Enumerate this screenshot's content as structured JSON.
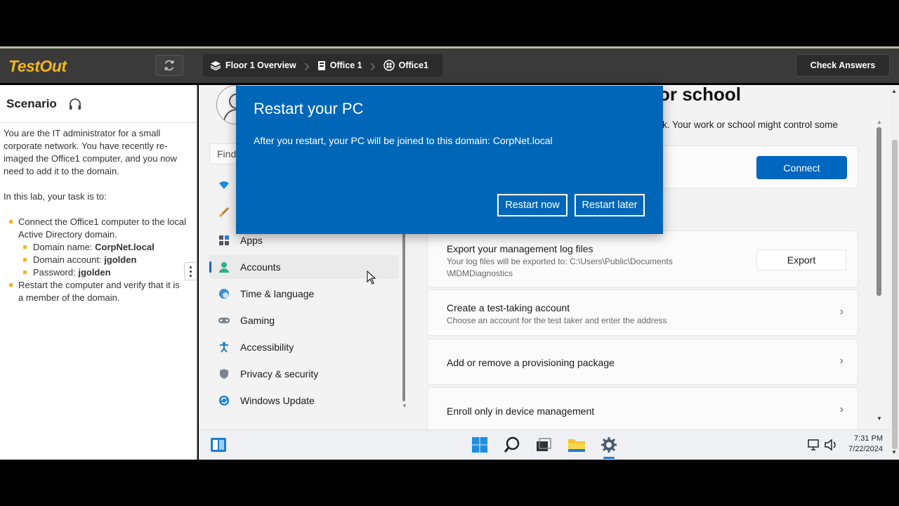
{
  "app": {
    "logo": "TestOut",
    "breadcrumbs": [
      "Floor 1 Overview",
      "Office 1",
      "Office1"
    ],
    "check_answers": "Check Answers"
  },
  "scenario": {
    "title": "Scenario",
    "intro": "You are the IT administrator for a small corporate network. You have recently re-imaged the Office1 computer, and you now need to add it to the domain.",
    "task_intro": "In this lab, your task is to:",
    "task1": "Connect the Office1 computer to the local Active Directory domain.",
    "domain_name_label": "Domain name:",
    "domain_name_value": "CorpNet.local",
    "domain_account_label": "Domain account:",
    "domain_account_value": "jgolden",
    "password_label": "Password:",
    "password_value": "jgolden",
    "task2": "Restart the computer and verify that it is a member of the domain."
  },
  "settings": {
    "find_placeholder": "Find",
    "nav": [
      {
        "label": "Apps",
        "icon": "apps-icon"
      },
      {
        "label": "Accounts",
        "icon": "accounts-icon",
        "active": true
      },
      {
        "label": "Time & language",
        "icon": "time-language-icon"
      },
      {
        "label": "Gaming",
        "icon": "gaming-icon"
      },
      {
        "label": "Accessibility",
        "icon": "accessibility-icon"
      },
      {
        "label": "Privacy & security",
        "icon": "privacy-security-icon"
      },
      {
        "label": "Windows Update",
        "icon": "windows-update-icon"
      }
    ],
    "page_title_fragment": "or school",
    "page_desc_fragment": "ork. Your work or school might control some",
    "connect_label": "Connect",
    "cards": [
      {
        "title": "Export your management log files",
        "subtitle_line1": "Your log files will be exported to: C:\\Users\\Public\\Documents",
        "subtitle_line2": "\\MDMDiagnostics",
        "button": "Export"
      },
      {
        "title": "Create a test-taking account",
        "subtitle": "Choose an account for the test taker and enter the address"
      },
      {
        "title": "Add or remove a provisioning package"
      },
      {
        "title": "Enroll only in device management"
      }
    ]
  },
  "dialog": {
    "title": "Restart your PC",
    "message": "After you restart, your PC will be joined to this domain: CorpNet.local",
    "restart_now": "Restart now",
    "restart_later": "Restart later"
  },
  "taskbar": {
    "time": "7:31 PM",
    "date": "7/22/2024"
  },
  "colors": {
    "brand": "#f2b51c",
    "dialog_bg": "#0067b8",
    "accent": "#0067c0"
  }
}
